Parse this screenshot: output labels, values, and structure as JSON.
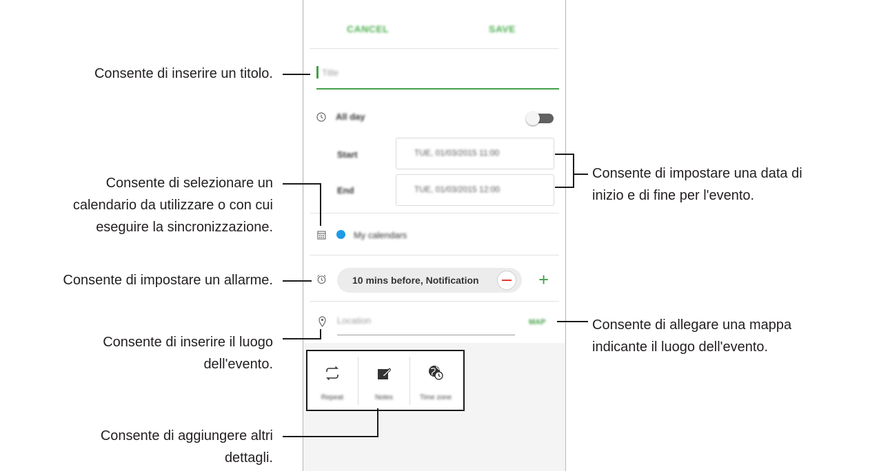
{
  "phone": {
    "cancel": "CANCEL",
    "save": "SAVE",
    "title_placeholder": "Title",
    "all_day": "All day",
    "start_label": "Start",
    "start_value": "TUE, 01/03/2015 11:00",
    "end_label": "End",
    "end_value": "TUE, 01/03/2015 12:00",
    "calendar_name": "My calendars",
    "calendar_color": "#1e9be6",
    "alarm_chip": "10 mins before, Notification",
    "location_placeholder": "Location",
    "map_button": "MAP",
    "tools": [
      {
        "label": "Repeat",
        "icon": "repeat-icon"
      },
      {
        "label": "Notes",
        "icon": "notes-icon"
      },
      {
        "label": "Time zone",
        "icon": "time-zone-icon"
      }
    ]
  },
  "callouts": {
    "title": "Consente di inserire un titolo.",
    "calendar_line1": "Consente di selezionare un",
    "calendar_line2": "calendario da utilizzare o con cui",
    "calendar_line3": "eseguire la sincronizzazione.",
    "alarm": "Consente di impostare un allarme.",
    "location_line1": "Consente di inserire il luogo",
    "location_line2": "dell'evento.",
    "details_line1": "Consente di aggiungere altri",
    "details_line2": "dettagli.",
    "dates_line1": "Consente di impostare una data di",
    "dates_line2": "inizio e di fine per l'evento.",
    "map_line1": "Consente di allegare una mappa",
    "map_line2": "indicante il luogo dell'evento."
  },
  "colors": {
    "accent_green": "#43a047",
    "alarm_remove": "#e53935"
  }
}
